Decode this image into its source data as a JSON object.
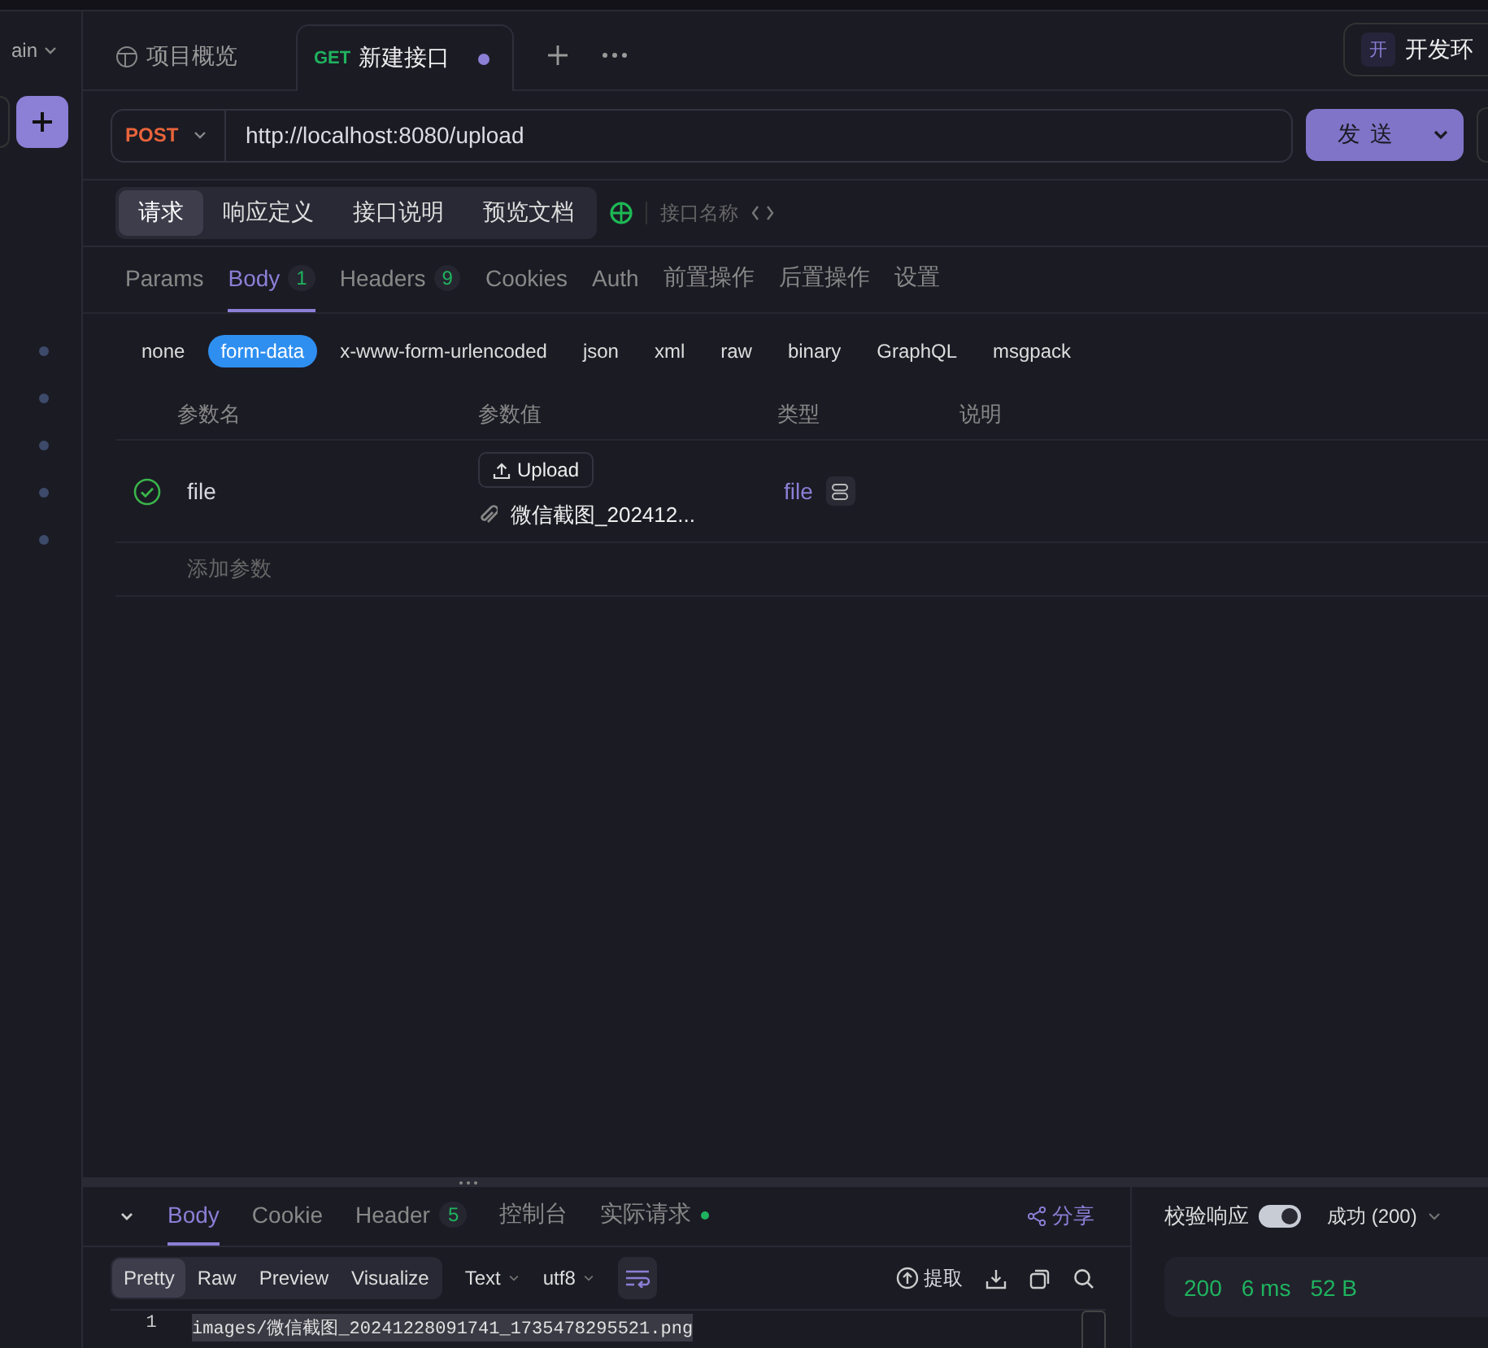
{
  "sidebar": {
    "branch": "ain"
  },
  "tabs": [
    {
      "kind": "overview",
      "label": "项目概览",
      "selected": false
    },
    {
      "kind": "request",
      "method": "GET",
      "label": "新建接口",
      "selected": true,
      "unsaved": true
    }
  ],
  "environment": {
    "badge": "开",
    "label": "开发环"
  },
  "request": {
    "method": "POST",
    "url": "http://localhost:8080/upload",
    "send": "发 送"
  },
  "view_tabs": [
    {
      "label": "请求",
      "selected": true
    },
    {
      "label": "响应定义",
      "selected": false
    },
    {
      "label": "接口说明",
      "selected": false
    },
    {
      "label": "预览文档",
      "selected": false
    }
  ],
  "name_placeholder": "接口名称",
  "param_tabs": [
    {
      "label": "Params",
      "selected": false
    },
    {
      "label": "Body",
      "count": "1",
      "selected": true
    },
    {
      "label": "Headers",
      "count": "9",
      "selected": false
    },
    {
      "label": "Cookies",
      "selected": false
    },
    {
      "label": "Auth",
      "selected": false
    },
    {
      "label": "前置操作",
      "selected": false
    },
    {
      "label": "后置操作",
      "selected": false
    },
    {
      "label": "设置",
      "selected": false
    }
  ],
  "body_types": [
    {
      "label": "none",
      "selected": false
    },
    {
      "label": "form-data",
      "selected": true
    },
    {
      "label": "x-www-form-urlencoded",
      "selected": false
    },
    {
      "label": "json",
      "selected": false
    },
    {
      "label": "xml",
      "selected": false
    },
    {
      "label": "raw",
      "selected": false
    },
    {
      "label": "binary",
      "selected": false
    },
    {
      "label": "GraphQL",
      "selected": false
    },
    {
      "label": "msgpack",
      "selected": false
    }
  ],
  "table": {
    "columns": [
      "参数名",
      "参数值",
      "类型",
      "说明"
    ],
    "rows": [
      {
        "enabled": true,
        "name": "file",
        "upload": "Upload",
        "file": "微信截图_202412...",
        "type": "file"
      }
    ],
    "add_placeholder": "添加参数"
  },
  "response": {
    "tabs": [
      {
        "label": "Body",
        "selected": true
      },
      {
        "label": "Cookie",
        "selected": false
      },
      {
        "label": "Header",
        "count": "5",
        "selected": false
      },
      {
        "label": "控制台",
        "selected": false
      },
      {
        "label": "实际请求",
        "dot": true,
        "selected": false
      }
    ],
    "share": "分享",
    "formats": [
      {
        "label": "Pretty",
        "selected": true
      },
      {
        "label": "Raw",
        "selected": false
      },
      {
        "label": "Preview",
        "selected": false
      },
      {
        "label": "Visualize",
        "selected": false
      }
    ],
    "content_type": "Text",
    "encoding": "utf8",
    "extract": "提取",
    "lines": [
      {
        "number": "1",
        "text": "images/微信截图_20241228091741_1735478295521.png"
      }
    ]
  },
  "validation": {
    "label": "校验响应",
    "on": true,
    "result": "成功 (200)"
  },
  "stats": [
    "200",
    "6 ms",
    "52 B"
  ]
}
